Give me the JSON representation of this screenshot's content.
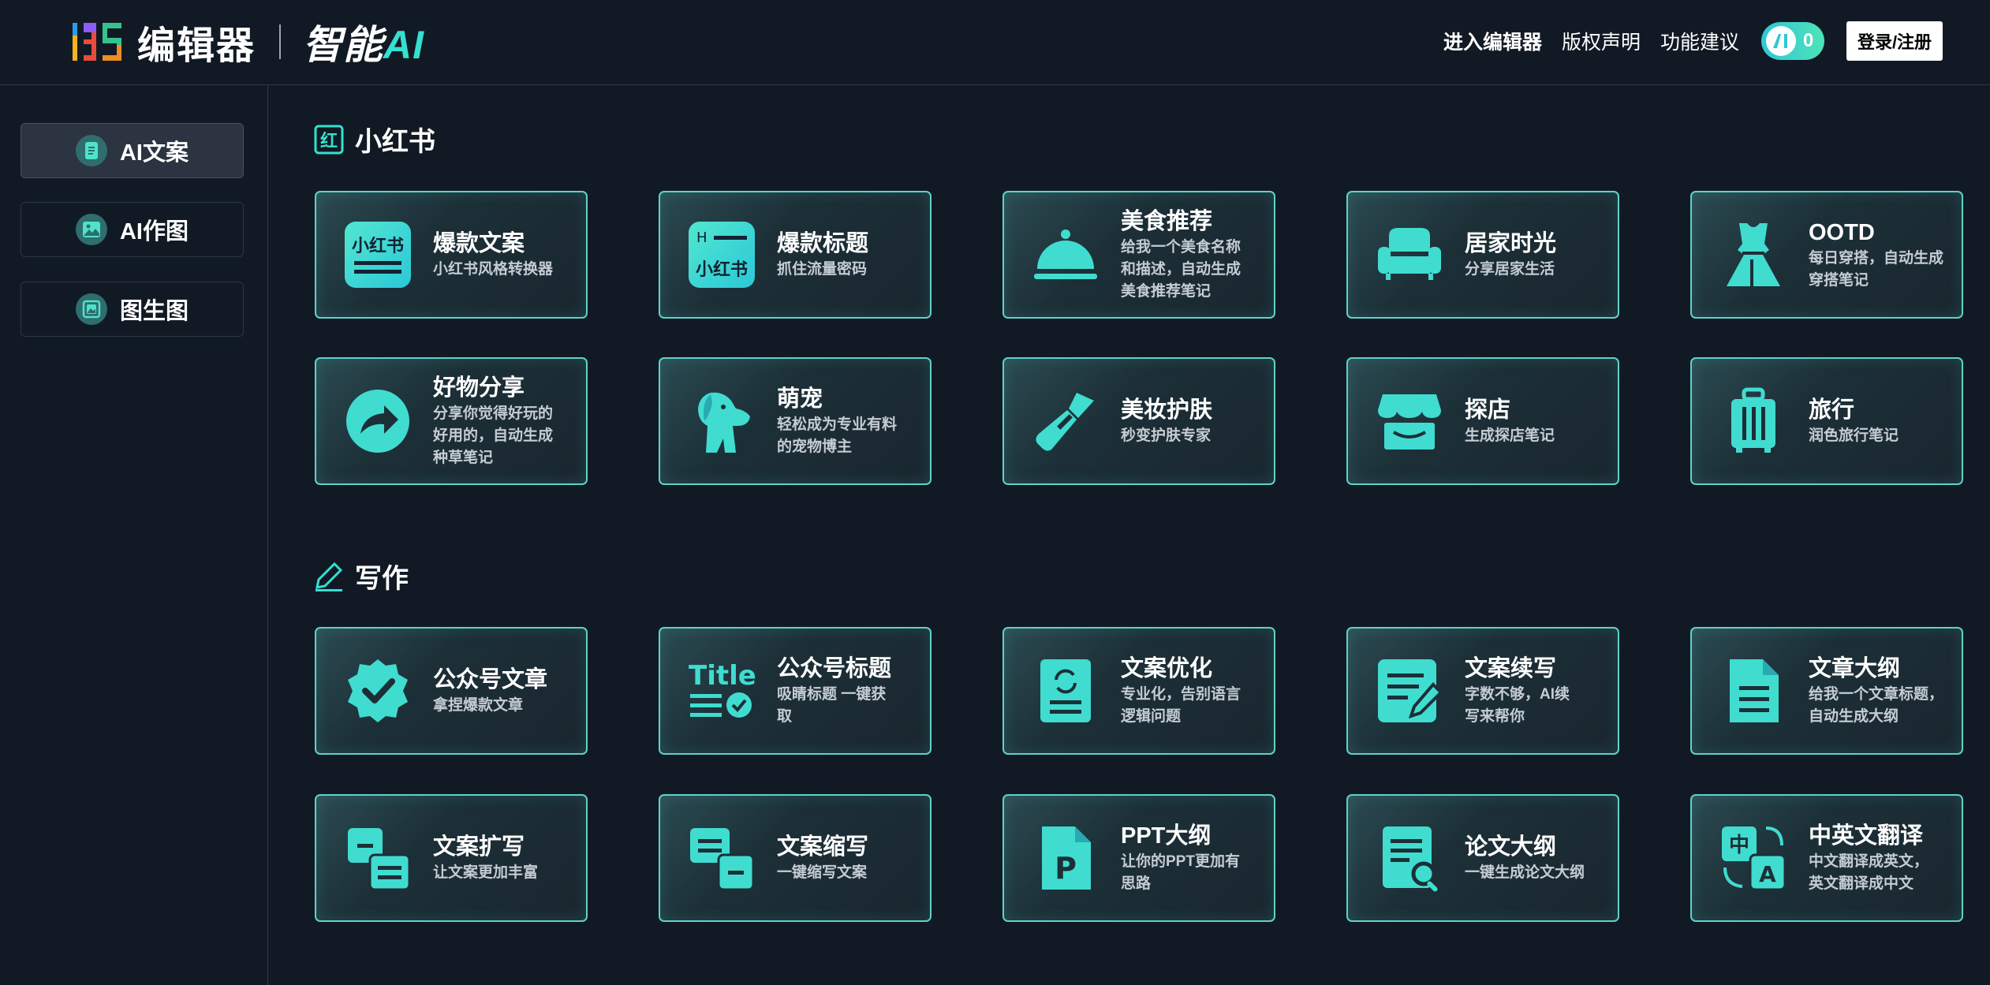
{
  "header": {
    "logo_text": "编辑器",
    "logo_ai_prefix": "智能",
    "logo_ai_suffix": "AI",
    "nav": [
      "进入编辑器",
      "版权声明",
      "功能建议"
    ],
    "ai_count": "0",
    "login_label": "登录/注册"
  },
  "sidebar": {
    "items": [
      {
        "label": "AI文案",
        "icon": "document-icon"
      },
      {
        "label": "AI作图",
        "icon": "picture-icon"
      },
      {
        "label": "图生图",
        "icon": "image-frame-icon"
      }
    ]
  },
  "sections": [
    {
      "title": "小红书",
      "icon": "xiaohongshu-badge-icon",
      "cards": [
        {
          "title": "爆款文案",
          "desc": [
            "小红书风格转换器"
          ],
          "icon": "xiaohongshu-logo-icon"
        },
        {
          "title": "爆款标题",
          "desc": [
            "抓住流量密码"
          ],
          "icon": "xiaohongshu-title-icon"
        },
        {
          "title": "美食推荐",
          "desc": [
            "给我一个美食名称",
            "和描述，自动生成",
            "美食推荐笔记"
          ],
          "icon": "cloche-icon"
        },
        {
          "title": "居家时光",
          "desc": [
            "分享居家生活"
          ],
          "icon": "sofa-icon"
        },
        {
          "title": "OOTD",
          "desc": [
            "每日穿搭，自动生成",
            "穿搭笔记"
          ],
          "icon": "dress-icon"
        },
        {
          "title": "好物分享",
          "desc": [
            "分享你觉得好玩的",
            "好用的，自动生成",
            "种草笔记"
          ],
          "icon": "share-arrow-icon"
        },
        {
          "title": "萌宠",
          "desc": [
            "轻松成为专业有料",
            "的宠物博主"
          ],
          "icon": "dog-icon"
        },
        {
          "title": "美妆护肤",
          "desc": [
            "秒变护肤专家"
          ],
          "icon": "lipstick-icon"
        },
        {
          "title": "探店",
          "desc": [
            "生成探店笔记"
          ],
          "icon": "store-icon"
        },
        {
          "title": "旅行",
          "desc": [
            "润色旅行笔记"
          ],
          "icon": "suitcase-icon"
        }
      ]
    },
    {
      "title": "写作",
      "icon": "pen-icon",
      "cards": [
        {
          "title": "公众号文章",
          "desc": [
            "拿捏爆款文章"
          ],
          "icon": "verified-badge-icon"
        },
        {
          "title": "公众号标题",
          "desc": [
            "吸睛标题 一键获",
            "取"
          ],
          "icon": "title-check-icon"
        },
        {
          "title": "文案优化",
          "desc": [
            "专业化，告别语言",
            "逻辑问题"
          ],
          "icon": "doc-refresh-icon"
        },
        {
          "title": "文案续写",
          "desc": [
            "字数不够，AI续",
            "写来帮你"
          ],
          "icon": "doc-edit-icon"
        },
        {
          "title": "文章大纲",
          "desc": [
            "给我一个文章标题，",
            "自动生成大纲"
          ],
          "icon": "doc-lines-icon"
        },
        {
          "title": "文案扩写",
          "desc": [
            "让文案更加丰富"
          ],
          "icon": "expand-blocks-icon"
        },
        {
          "title": "文案缩写",
          "desc": [
            "一键缩写文案"
          ],
          "icon": "shrink-blocks-icon"
        },
        {
          "title": "PPT大纲",
          "desc": [
            "让你的PPT更加有",
            "思路"
          ],
          "icon": "ppt-file-icon"
        },
        {
          "title": "论文大纲",
          "desc": [
            "一键生成论文大纲"
          ],
          "icon": "doc-search-icon"
        },
        {
          "title": "中英文翻译",
          "desc": [
            "中文翻译成英文，",
            "英文翻译成中文"
          ],
          "icon": "translate-icon"
        }
      ]
    }
  ],
  "colors": {
    "accent": "#34e0d0",
    "background": "#111a24",
    "card_border": "#5fd2c9"
  }
}
